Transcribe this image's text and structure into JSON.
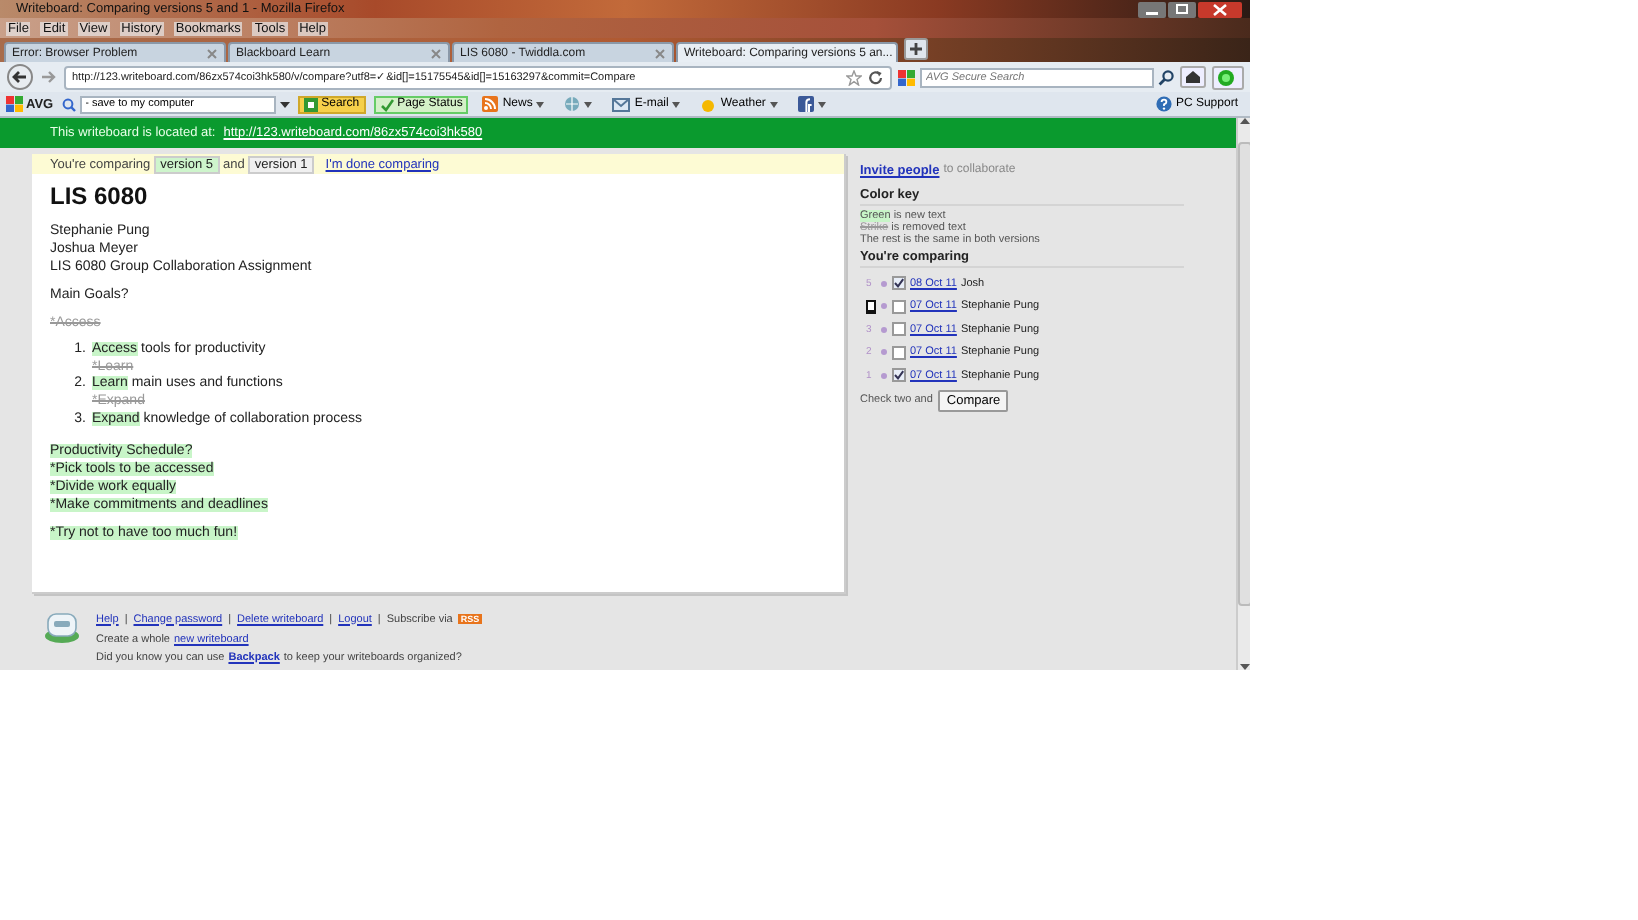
{
  "window": {
    "title": "Writeboard: Comparing versions 5 and 1 - Mozilla Firefox"
  },
  "menu": [
    "File",
    "Edit",
    "View",
    "History",
    "Bookmarks",
    "Tools",
    "Help"
  ],
  "tabs": [
    {
      "label": "Error: Browser Problem",
      "selected": false
    },
    {
      "label": "Blackboard Learn",
      "selected": false
    },
    {
      "label": "LIS 6080 - Twiddla.com",
      "selected": false
    },
    {
      "label": "Writeboard: Comparing versions 5 an...",
      "selected": true
    }
  ],
  "address": {
    "value": "http://123.writeboard.com/86zx574coi3hk580/v/compare?utf8=✓&id[]=15175545&id[]=15163297&commit=Compare"
  },
  "search": {
    "placeholder": "AVG Secure Search"
  },
  "toolbar": {
    "brand": "AVG",
    "query": "- save to my computer",
    "search_button": "Search",
    "page_status": "Page Status",
    "news": "News",
    "email": "E-mail",
    "weather": "Weather",
    "support": "PC Support"
  },
  "banner": {
    "text": "This writeboard is located at:",
    "link": "http://123.writeboard.com/86zx574coi3hk580"
  },
  "compare_bar": {
    "prefix": "You're comparing",
    "new_version": "version 5",
    "joiner": "and",
    "old_version": "version 1",
    "done_link": "I'm done comparing"
  },
  "document": {
    "title": "LIS 6080",
    "blocks": [
      {
        "kind": "lines",
        "lines": [
          [
            {
              "text": "Stephanie Pung",
              "kind": "same"
            }
          ],
          [
            {
              "text": "Joshua Meyer",
              "kind": "same"
            }
          ],
          [
            {
              "text": "LIS 6080 Group Collaboration Assignment",
              "kind": "same"
            }
          ]
        ]
      },
      {
        "kind": "lines",
        "lines": [
          [
            {
              "text": "Main Goals?",
              "kind": "same"
            }
          ]
        ]
      },
      {
        "kind": "lines",
        "lines": [
          [
            {
              "text": "*Access",
              "kind": "removed"
            }
          ]
        ]
      },
      {
        "kind": "list",
        "items": [
          {
            "number": "1.",
            "segments": [
              {
                "text": "Access",
                "kind": "added"
              },
              {
                "text": " tools for productivity",
                "kind": "same"
              }
            ]
          },
          {
            "segments": [
              {
                "text": "*Learn",
                "kind": "removed"
              }
            ]
          },
          {
            "number": "2.",
            "segments": [
              {
                "text": "Learn",
                "kind": "added"
              },
              {
                "text": " main uses and functions",
                "kind": "same"
              }
            ]
          },
          {
            "segments": [
              {
                "text": "*Expand",
                "kind": "removed"
              }
            ]
          },
          {
            "number": "3.",
            "segments": [
              {
                "text": "Expand",
                "kind": "added"
              },
              {
                "text": " knowledge of collaboration process",
                "kind": "same"
              }
            ]
          }
        ]
      },
      {
        "kind": "lines",
        "lines": [
          [
            {
              "text": "Productivity Schedule?",
              "kind": "added"
            }
          ],
          [
            {
              "text": "*Pick tools to be accessed",
              "kind": "added"
            }
          ],
          [
            {
              "text": "*Divide work equally",
              "kind": "added"
            }
          ],
          [
            {
              "text": "*Make commitments and deadlines",
              "kind": "added"
            }
          ]
        ]
      },
      {
        "kind": "lines",
        "lines": [
          [
            {
              "text": "*Try not to have too much fun!",
              "kind": "added"
            }
          ]
        ]
      }
    ]
  },
  "sidebar": {
    "invite_link": "Invite people",
    "invite_text": "to collaborate",
    "color_key_heading": "Color key",
    "color_key": [
      [
        {
          "text": "Green",
          "kind": "added"
        },
        {
          "text": " is new text",
          "kind": "same"
        }
      ],
      [
        {
          "text": "Strike",
          "kind": "removed"
        },
        {
          "text": " is removed text",
          "kind": "same"
        }
      ],
      [
        {
          "text": "The rest is the same in both versions",
          "kind": "same"
        }
      ]
    ],
    "comparing_heading": "You're comparing",
    "versions": [
      {
        "number": "5",
        "checked": true,
        "date": "08 Oct 11",
        "author": "Josh"
      },
      {
        "checked": false,
        "date": "07 Oct 11",
        "author": "Stephanie Pung"
      },
      {
        "number": "3",
        "checked": false,
        "date": "07 Oct 11",
        "author": "Stephanie Pung"
      },
      {
        "number": "2",
        "checked": false,
        "date": "07 Oct 11",
        "author": "Stephanie Pung"
      },
      {
        "number": "1",
        "checked": true,
        "date": "07 Oct 11",
        "author": "Stephanie Pung"
      }
    ],
    "compare_text": "Check two and",
    "compare_button": "Compare"
  },
  "footer": {
    "links": [
      "Help",
      "Change password",
      "Delete writeboard",
      "Logout"
    ],
    "separator": "|",
    "subscribe": "Subscribe via",
    "rss": "RSS",
    "create_text": "Create a whole",
    "create_link": "new writeboard",
    "tip_before": "Did you know you can use",
    "tip_link": "Backpack",
    "tip_after": "to keep your writeboards organized?"
  }
}
